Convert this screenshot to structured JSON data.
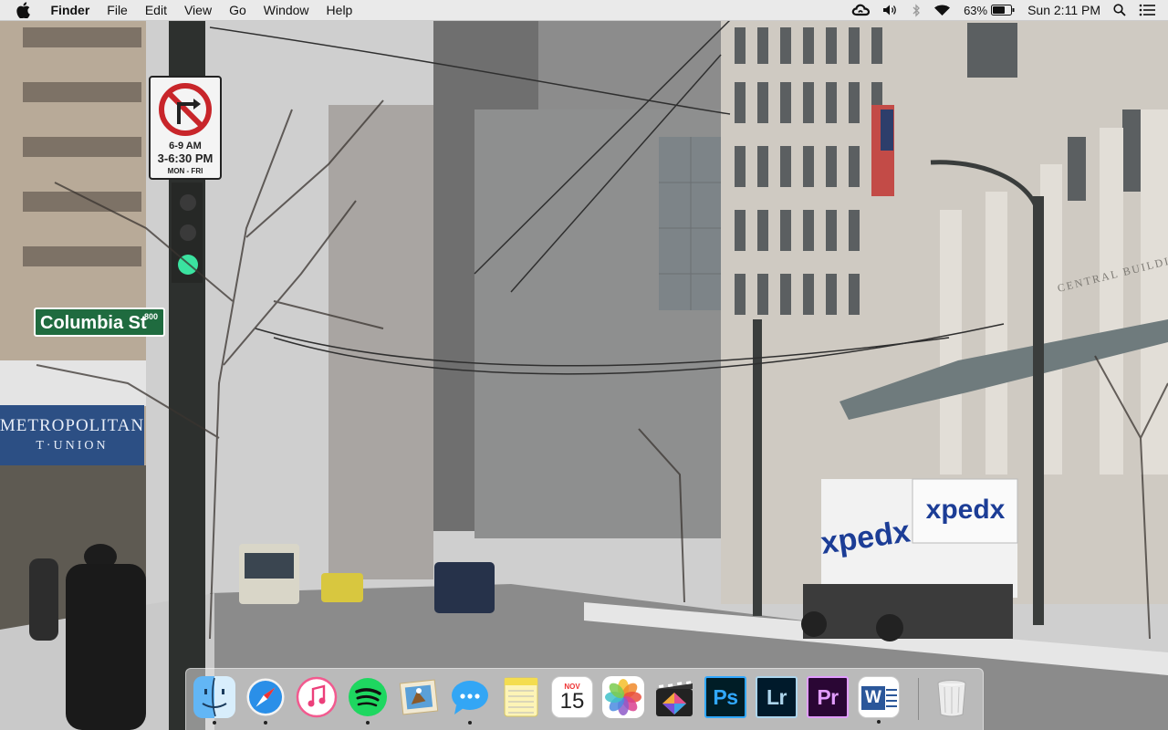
{
  "menubar": {
    "app_name": "Finder",
    "menus": [
      "File",
      "Edit",
      "View",
      "Go",
      "Window",
      "Help"
    ],
    "battery_percent": "63%",
    "clock": "Sun 2:11 PM",
    "status_icons": [
      "creative-cloud-icon",
      "volume-icon",
      "bluetooth-icon",
      "wifi-icon",
      "battery-icon",
      "spotlight-icon",
      "notification-center-icon"
    ]
  },
  "wallpaper": {
    "street_sign": "Columbia St",
    "street_number": "800",
    "parking_sign_lines": [
      "6-9 AM",
      "3-6:30 PM",
      "MON - FRI"
    ],
    "bank_sign_line1": "METROPOLITAN",
    "bank_sign_line2": "T·UNION",
    "truck_logo": "xpedx",
    "building_inscription": "CENTRAL BUILDING"
  },
  "dock": {
    "items": [
      {
        "name": "Finder",
        "icon": "finder-icon",
        "running": true
      },
      {
        "name": "Safari",
        "icon": "safari-icon",
        "running": true
      },
      {
        "name": "iTunes",
        "icon": "itunes-icon",
        "running": false
      },
      {
        "name": "Spotify",
        "icon": "spotify-icon",
        "running": true
      },
      {
        "name": "Mail",
        "icon": "mail-icon",
        "running": false
      },
      {
        "name": "Messages",
        "icon": "messages-icon",
        "running": true
      },
      {
        "name": "Notes",
        "icon": "notes-icon",
        "running": false
      },
      {
        "name": "Calendar",
        "icon": "calendar-icon",
        "running": false,
        "month": "NOV",
        "day": "15"
      },
      {
        "name": "Photos",
        "icon": "photos-icon",
        "running": false
      },
      {
        "name": "Final Cut Pro",
        "icon": "final-cut-pro-icon",
        "running": false
      },
      {
        "name": "Photoshop",
        "icon": "photoshop-icon",
        "running": false,
        "label": "Ps"
      },
      {
        "name": "Lightroom",
        "icon": "lightroom-icon",
        "running": false,
        "label": "Lr"
      },
      {
        "name": "Premiere Pro",
        "icon": "premiere-pro-icon",
        "running": false,
        "label": "Pr"
      },
      {
        "name": "Word",
        "icon": "word-icon",
        "running": true,
        "label": "W"
      },
      {
        "name": "Trash",
        "icon": "trash-icon",
        "running": false
      }
    ]
  },
  "colors": {
    "menubar_bg": "#ececec",
    "photoshop_accent": "#31a8ff",
    "lightroom_accent": "#add5ec",
    "premiere_accent": "#e29dff",
    "spotify_green": "#1ed760",
    "word_blue": "#2b579a"
  }
}
